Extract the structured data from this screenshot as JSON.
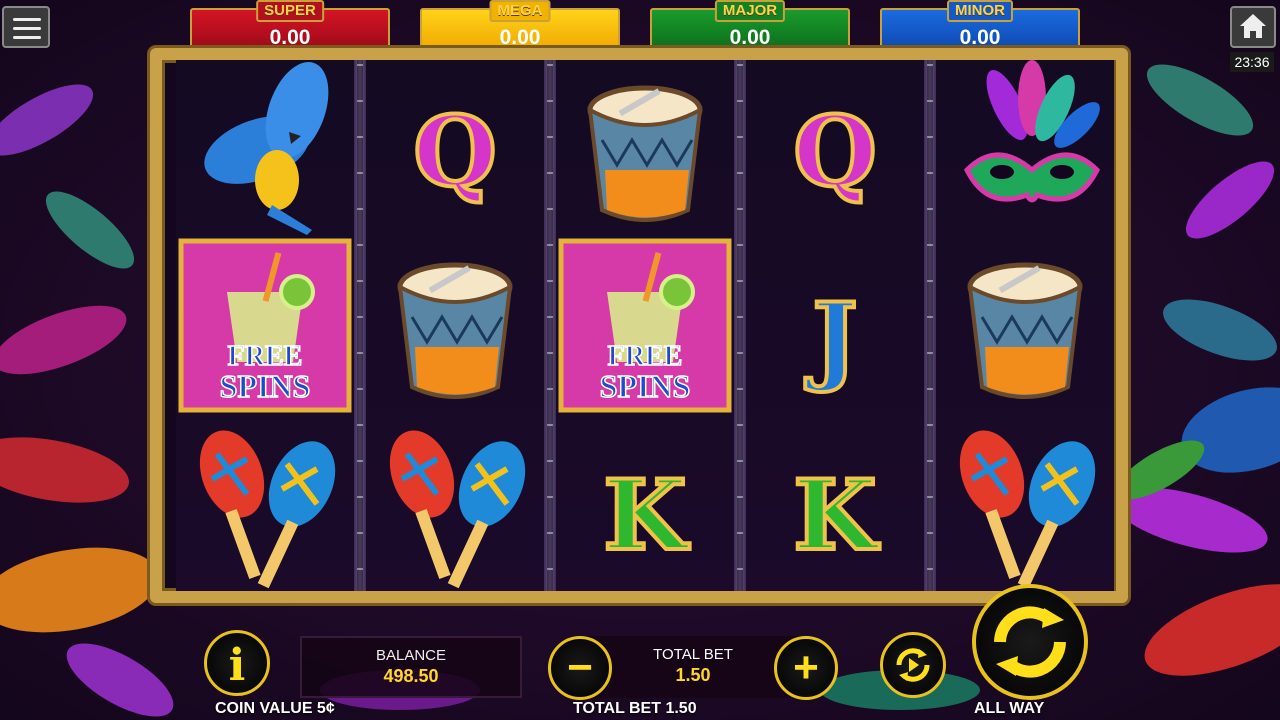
{
  "jackpots": [
    {
      "name": "SUPER",
      "value": "0.00",
      "color": "#c8101f"
    },
    {
      "name": "MEGA",
      "value": "0.00",
      "color": "#f5b800"
    },
    {
      "name": "MAJOR",
      "value": "0.00",
      "color": "#157f25"
    },
    {
      "name": "MINOR",
      "value": "0.00",
      "color": "#1459c8"
    }
  ],
  "clock": "23:36",
  "reels": [
    [
      "parrot",
      "free-spins",
      "maracas"
    ],
    [
      "queen",
      "drum",
      "maracas"
    ],
    [
      "drum",
      "free-spins",
      "king"
    ],
    [
      "queen",
      "jack",
      "king"
    ],
    [
      "carnival-mask",
      "drum",
      "maracas"
    ]
  ],
  "symbols": {
    "queen": "Q",
    "jack": "J",
    "king": "K",
    "free_spins_line1": "FREE",
    "free_spins_line2": "SPINS"
  },
  "panel": {
    "info_glyph": "i",
    "balance_label": "BALANCE",
    "balance_value": "498.50",
    "total_bet_label": "TOTAL BET",
    "total_bet_value": "1.50",
    "minus": "−",
    "plus": "+",
    "coin_value": "COIN VALUE 5¢",
    "total_bet_footer": "TOTAL BET 1.50",
    "all_way": "ALL WAY"
  },
  "colors": {
    "accent": "#ffde1a",
    "frame": "#c9a149"
  }
}
